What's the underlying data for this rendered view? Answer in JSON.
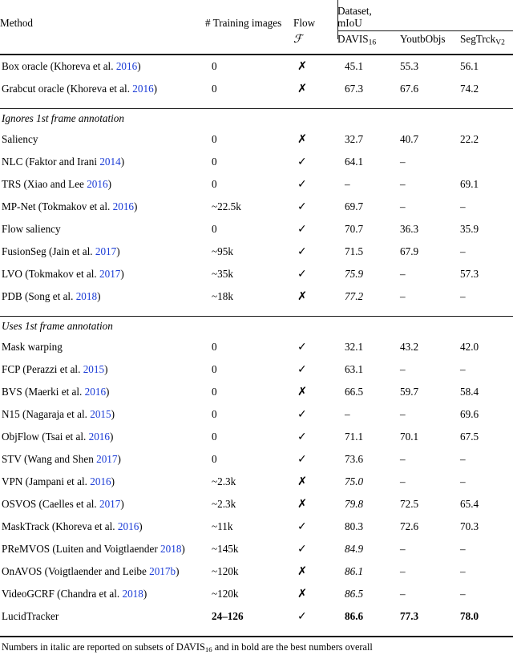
{
  "header": {
    "method": "Method",
    "training_images": "# Training images",
    "flow": "Flow",
    "flow_sub": "ℱ",
    "dataset_group": "Dataset, mIoU",
    "col_davis": "DAVIS",
    "col_davis_sub": "16",
    "col_youtb": "YoutbObjs",
    "col_segtrck": "SegTrck",
    "col_segtrck_sub": "V2"
  },
  "glyphs": {
    "check": "✓",
    "cross": "✗",
    "dash": "–"
  },
  "sections": {
    "ignores": "Ignores 1st frame annotation",
    "uses": "Uses 1st frame annotation"
  },
  "footnote": {
    "part1": "Numbers in italic are reported on subsets of DAVIS",
    "sub": "16",
    "part2": " and in bold are the best numbers overall"
  },
  "colors": {
    "citation_link": "#1a3bd6",
    "rule": "#1a1a1a",
    "text": "#000000",
    "background": "#ffffff"
  },
  "rows": {
    "oracles": [
      {
        "method_pre": "Box oracle (Khoreva et al. ",
        "method_cite": "2016",
        "method_post": ")",
        "train": "0",
        "flow": "cross",
        "davis": "45.1",
        "youtb": "55.3",
        "segtrck": "56.1"
      },
      {
        "method_pre": "Grabcut oracle (Khoreva et al. ",
        "method_cite": "2016",
        "method_post": ")",
        "train": "0",
        "flow": "cross",
        "davis": "67.3",
        "youtb": "67.6",
        "segtrck": "74.2"
      }
    ],
    "ignores_1st_frame": [
      {
        "method_pre": "Saliency",
        "method_cite": "",
        "method_post": "",
        "train": "0",
        "flow": "cross",
        "davis": "32.7",
        "youtb": "40.7",
        "segtrck": "22.2"
      },
      {
        "method_pre": "NLC (Faktor and Irani ",
        "method_cite": "2014",
        "method_post": ")",
        "train": "0",
        "flow": "check",
        "davis": "64.1",
        "youtb": "–",
        "segtrck": ""
      },
      {
        "method_pre": "TRS (Xiao and Lee ",
        "method_cite": "2016",
        "method_post": ")",
        "train": "0",
        "flow": "check",
        "davis": "–",
        "youtb": "–",
        "segtrck": "69.1"
      },
      {
        "method_pre": "MP-Net (Tokmakov et al. ",
        "method_cite": "2016",
        "method_post": ")",
        "train": "~22.5k",
        "flow": "check",
        "davis": "69.7",
        "youtb": "–",
        "segtrck": "–"
      },
      {
        "method_pre": "Flow saliency",
        "method_cite": "",
        "method_post": "",
        "train": "0",
        "flow": "check",
        "davis": "70.7",
        "youtb": "36.3",
        "segtrck": "35.9"
      },
      {
        "method_pre": "FusionSeg (Jain et al. ",
        "method_cite": "2017",
        "method_post": ")",
        "train": "~95k",
        "flow": "check",
        "davis": "71.5",
        "youtb": "67.9",
        "segtrck": "–"
      },
      {
        "method_pre": "LVO (Tokmakov et al. ",
        "method_cite": "2017",
        "method_post": ")",
        "train": "~35k",
        "flow": "check",
        "davis": "75.9",
        "davis_italic": true,
        "youtb": "–",
        "segtrck": "57.3"
      },
      {
        "method_pre": "PDB (Song et al. ",
        "method_cite": "2018",
        "method_post": ")",
        "train": "~18k",
        "flow": "cross",
        "davis": "77.2",
        "davis_italic": true,
        "youtb": "–",
        "segtrck": "–"
      }
    ],
    "uses_1st_frame": [
      {
        "method_pre": "Mask warping",
        "method_cite": "",
        "method_post": "",
        "train": "0",
        "flow": "check",
        "davis": "32.1",
        "youtb": "43.2",
        "segtrck": "42.0"
      },
      {
        "method_pre": "FCP (Perazzi et al. ",
        "method_cite": "2015",
        "method_post": ")",
        "train": "0",
        "flow": "check",
        "davis": "63.1",
        "youtb": "–",
        "segtrck": "–"
      },
      {
        "method_pre": "BVS (Maerki et al. ",
        "method_cite": "2016",
        "method_post": ")",
        "train": "0",
        "flow": "cross",
        "davis": "66.5",
        "youtb": "59.7",
        "segtrck": "58.4"
      },
      {
        "method_pre": "N15 (Nagaraja et al. ",
        "method_cite": "2015",
        "method_post": ")",
        "train": "0",
        "flow": "check",
        "davis": "–",
        "youtb": "–",
        "segtrck": "69.6"
      },
      {
        "method_pre": "ObjFlow (Tsai et al. ",
        "method_cite": "2016",
        "method_post": ")",
        "train": "0",
        "flow": "check",
        "davis": "71.1",
        "youtb": "70.1",
        "segtrck": "67.5"
      },
      {
        "method_pre": "STV (Wang and Shen ",
        "method_cite": "2017",
        "method_post": ")",
        "train": "0",
        "flow": "check",
        "davis": "73.6",
        "youtb": "–",
        "segtrck": "–"
      },
      {
        "method_pre": "VPN (Jampani et al. ",
        "method_cite": "2016",
        "method_post": ")",
        "train": "~2.3k",
        "flow": "cross",
        "davis": "75.0",
        "davis_italic": true,
        "youtb": "–",
        "segtrck": "–"
      },
      {
        "method_pre": "OSVOS (Caelles et al. ",
        "method_cite": "2017",
        "method_post": ")",
        "train": "~2.3k",
        "flow": "cross",
        "davis": "79.8",
        "davis_italic": true,
        "youtb": "72.5",
        "segtrck": "65.4"
      },
      {
        "method_pre": "MaskTrack (Khoreva et al. ",
        "method_cite": "2016",
        "method_post": ")",
        "train": "~11k",
        "flow": "check",
        "davis": "80.3",
        "youtb": "72.6",
        "segtrck": "70.3"
      },
      {
        "method_pre": "PReMVOS (Luiten and Voigtlaender ",
        "method_cite": "2018",
        "method_post": ")",
        "train": "~145k",
        "flow": "check",
        "davis": "84.9",
        "davis_italic": true,
        "youtb": "–",
        "segtrck": "–"
      },
      {
        "method_pre": "OnAVOS (Voigtlaender and Leibe ",
        "method_cite": "2017b",
        "method_post": ")",
        "train": "~120k",
        "flow": "cross",
        "davis": "86.1",
        "davis_italic": true,
        "youtb": "–",
        "segtrck": "–"
      },
      {
        "method_pre": "VideoGCRF (Chandra et al. ",
        "method_cite": "2018",
        "method_post": ")",
        "train": "~120k",
        "flow": "cross",
        "davis": "86.5",
        "davis_italic": true,
        "youtb": "–",
        "segtrck": "–"
      },
      {
        "method_pre": "LucidTracker",
        "method_cite": "",
        "method_post": "",
        "train": "24–126",
        "train_bold": true,
        "flow": "check",
        "davis": "86.6",
        "davis_bold": true,
        "youtb": "77.3",
        "youtb_bold": true,
        "segtrck": "78.0",
        "segtrck_bold": true
      }
    ]
  }
}
